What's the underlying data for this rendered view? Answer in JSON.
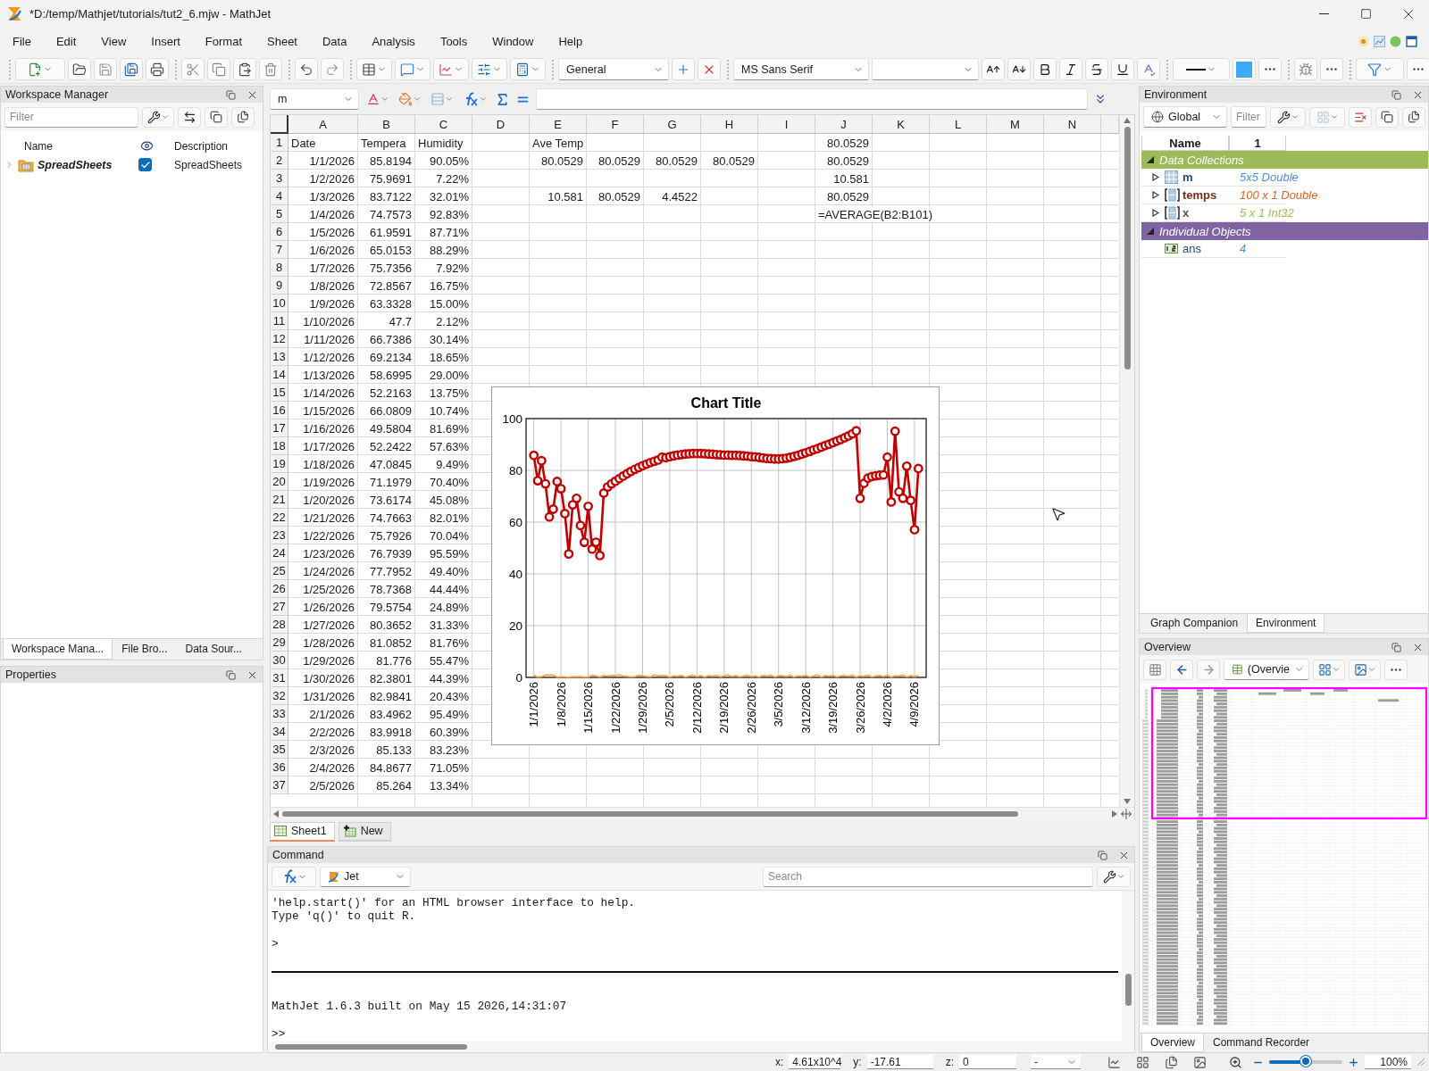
{
  "window": {
    "title": "*D:/temp/Mathjet/tutorials/tut2_6.mjw - MathJet"
  },
  "menu": [
    "File",
    "Edit",
    "View",
    "Insert",
    "Format",
    "Sheet",
    "Data",
    "Analysis",
    "Tools",
    "Window",
    "Help"
  ],
  "toolbar": {
    "number_format": "General",
    "font": "MS Sans Serif"
  },
  "workspace_manager": {
    "title": "Workspace Manager",
    "filter": {
      "placeholder": "Filter"
    },
    "columns": [
      "Name",
      "Description"
    ],
    "items": [
      {
        "name": "SpreadSheets",
        "description": "SpreadSheets",
        "checked": true,
        "expanded": false
      }
    ],
    "tabs": [
      {
        "label": "Workspace Mana...",
        "selected": true
      },
      {
        "label": "File Bro...",
        "selected": false
      },
      {
        "label": "Data Sour...",
        "selected": false
      }
    ]
  },
  "properties": {
    "title": "Properties"
  },
  "formula_bar": {
    "cell_name": "m"
  },
  "sheet": {
    "columns": [
      "A",
      "B",
      "C",
      "D",
      "E",
      "F",
      "G",
      "H",
      "I",
      "J",
      "K",
      "L",
      "M",
      "N"
    ],
    "rows": [
      {
        "number": "1",
        "labels": {
          "A": "Date",
          "B": "Tempera",
          "C": "Humidity",
          "E": "Ave Temp"
        },
        "values": {
          "J": "80.0529"
        }
      },
      {
        "number": "2",
        "values": {
          "A": "1/1/2026",
          "B": "85.8194",
          "C": "90.05%",
          "E": "80.0529",
          "F": "80.0529",
          "G": "80.0529",
          "H": "80.0529",
          "J": "80.0529"
        }
      },
      {
        "number": "3",
        "values": {
          "A": "1/2/2026",
          "B": "75.9691",
          "C": "7.22%",
          "J": "10.581"
        }
      },
      {
        "number": "4",
        "values": {
          "A": "1/3/2026",
          "B": "83.7122",
          "C": "32.01%",
          "E": "10.581",
          "F": "80.0529",
          "G": "4.4522",
          "J": "80.0529"
        }
      },
      {
        "number": "5",
        "values": {
          "A": "1/4/2026",
          "B": "74.7573",
          "C": "92.83%"
        },
        "labels": {
          "J": "=AVERAGE(B2:B101)"
        }
      },
      {
        "number": "6",
        "values": {
          "A": "1/5/2026",
          "B": "61.9591",
          "C": "87.71%"
        }
      },
      {
        "number": "7",
        "values": {
          "A": "1/6/2026",
          "B": "65.0153",
          "C": "88.29%"
        }
      },
      {
        "number": "8",
        "values": {
          "A": "1/7/2026",
          "B": "75.7356",
          "C": "7.92%"
        }
      },
      {
        "number": "9",
        "values": {
          "A": "1/8/2026",
          "B": "72.8567",
          "C": "16.75%"
        }
      },
      {
        "number": "10",
        "values": {
          "A": "1/9/2026",
          "B": "63.3328",
          "C": "15.00%"
        }
      },
      {
        "number": "11",
        "values": {
          "A": "1/10/2026",
          "B": "47.7",
          "C": "2.12%"
        }
      },
      {
        "number": "12",
        "values": {
          "A": "1/11/2026",
          "B": "66.7386",
          "C": "30.14%"
        }
      },
      {
        "number": "13",
        "values": {
          "A": "1/12/2026",
          "B": "69.2134",
          "C": "18.65%"
        }
      },
      {
        "number": "14",
        "values": {
          "A": "1/13/2026",
          "B": "58.6995",
          "C": "29.00%"
        }
      },
      {
        "number": "15",
        "values": {
          "A": "1/14/2026",
          "B": "52.2163",
          "C": "13.75%"
        }
      },
      {
        "number": "16",
        "values": {
          "A": "1/15/2026",
          "B": "66.0809",
          "C": "10.74%"
        }
      },
      {
        "number": "17",
        "values": {
          "A": "1/16/2026",
          "B": "49.5804",
          "C": "81.69%"
        }
      },
      {
        "number": "18",
        "values": {
          "A": "1/17/2026",
          "B": "52.2422",
          "C": "57.63%"
        }
      },
      {
        "number": "19",
        "values": {
          "A": "1/18/2026",
          "B": "47.0845",
          "C": "9.49%"
        }
      },
      {
        "number": "20",
        "values": {
          "A": "1/19/2026",
          "B": "71.1979",
          "C": "70.40%"
        }
      },
      {
        "number": "21",
        "values": {
          "A": "1/20/2026",
          "B": "73.6174",
          "C": "45.08%"
        }
      },
      {
        "number": "22",
        "values": {
          "A": "1/21/2026",
          "B": "74.7663",
          "C": "82.01%"
        }
      },
      {
        "number": "23",
        "values": {
          "A": "1/22/2026",
          "B": "75.7926",
          "C": "70.04%"
        }
      },
      {
        "number": "24",
        "values": {
          "A": "1/23/2026",
          "B": "76.7939",
          "C": "95.59%"
        }
      },
      {
        "number": "25",
        "values": {
          "A": "1/24/2026",
          "B": "77.7952",
          "C": "49.40%"
        }
      },
      {
        "number": "26",
        "values": {
          "A": "1/25/2026",
          "B": "78.7368",
          "C": "44.44%"
        }
      },
      {
        "number": "27",
        "values": {
          "A": "1/26/2026",
          "B": "79.5754",
          "C": "24.89%"
        }
      },
      {
        "number": "28",
        "values": {
          "A": "1/27/2026",
          "B": "80.3652",
          "C": "31.33%"
        }
      },
      {
        "number": "29",
        "values": {
          "A": "1/28/2026",
          "B": "81.0852",
          "C": "81.76%"
        }
      },
      {
        "number": "30",
        "values": {
          "A": "1/29/2026",
          "B": "81.776",
          "C": "55.47%"
        }
      },
      {
        "number": "31",
        "values": {
          "A": "1/30/2026",
          "B": "82.3801",
          "C": "44.39%"
        }
      },
      {
        "number": "32",
        "values": {
          "A": "1/31/2026",
          "B": "82.9841",
          "C": "20.43%"
        }
      },
      {
        "number": "33",
        "values": {
          "A": "2/1/2026",
          "B": "83.4962",
          "C": "95.49%"
        }
      },
      {
        "number": "34",
        "values": {
          "A": "2/2/2026",
          "B": "83.9918",
          "C": "60.39%"
        }
      },
      {
        "number": "35",
        "values": {
          "A": "2/3/2026",
          "B": "85.133",
          "C": "83.23%"
        }
      },
      {
        "number": "36",
        "values": {
          "A": "2/4/2026",
          "B": "84.8677",
          "C": "71.05%"
        }
      },
      {
        "number": "37",
        "values": {
          "A": "2/5/2026",
          "B": "85.264",
          "C": "13.34%"
        }
      }
    ],
    "chart_data": {
      "type": "line",
      "title": "Chart Title",
      "grid": true,
      "categories": [
        "1/1/2026",
        null,
        null,
        null,
        null,
        null,
        null,
        "1/8/2026",
        null,
        null,
        null,
        null,
        null,
        null,
        "1/15/2026",
        null,
        null,
        null,
        null,
        null,
        null,
        "1/22/2026",
        null,
        null,
        null,
        null,
        null,
        null,
        "1/29/2026",
        null,
        null,
        null,
        null,
        null,
        null,
        "2/5/2026",
        null,
        null,
        null,
        null,
        null,
        null,
        "2/12/2026",
        null,
        null,
        null,
        null,
        null,
        null,
        "2/19/2026",
        null,
        null,
        null,
        null,
        null,
        null,
        "2/26/2026",
        null,
        null,
        null,
        null,
        null,
        null,
        "3/5/2026",
        null,
        null,
        null,
        null,
        null,
        null,
        "3/12/2026",
        null,
        null,
        null,
        null,
        null,
        null,
        "3/19/2026",
        null,
        null,
        null,
        null,
        null,
        null,
        "3/26/2026",
        null,
        null,
        null,
        null,
        null,
        null,
        "4/2/2026",
        null,
        null,
        null,
        null,
        null,
        null,
        "4/9/2026",
        null
      ],
      "ylim": [
        0,
        100
      ],
      "yticks": [
        {
          "value": 0,
          "label": "0"
        },
        {
          "value": 20,
          "label": "20"
        },
        {
          "value": 40,
          "label": "40"
        },
        {
          "value": 60,
          "label": "60"
        },
        {
          "value": 80,
          "label": "80"
        },
        {
          "value": 100,
          "label": "100"
        }
      ],
      "series": [
        {
          "color": "#c00000",
          "marker": "circle",
          "values": [
            85.8,
            76.0,
            83.7,
            74.8,
            62.0,
            65.0,
            75.7,
            72.9,
            63.3,
            47.7,
            66.7,
            69.2,
            58.7,
            52.2,
            66.1,
            49.6,
            52.2,
            47.1,
            71.2,
            73.6,
            74.8,
            75.8,
            76.8,
            77.8,
            78.7,
            79.6,
            80.4,
            81.1,
            81.8,
            82.4,
            83.0,
            83.5,
            84.0,
            85.1,
            84.9,
            85.3,
            85.6,
            85.9,
            86.1,
            86.3,
            86.4,
            86.5,
            86.5,
            86.5,
            86.4,
            86.3,
            86.2,
            86.1,
            86.0,
            85.9,
            85.9,
            85.8,
            85.8,
            85.7,
            85.6,
            85.5,
            85.3,
            85.2,
            85.0,
            84.8,
            84.6,
            84.5,
            84.4,
            84.4,
            84.5,
            84.7,
            85.0,
            85.4,
            85.8,
            86.3,
            86.8,
            87.3,
            87.9,
            88.4,
            89.0,
            89.6,
            90.1,
            90.7,
            91.3,
            91.9,
            92.6,
            93.3,
            94.1,
            95.3,
            69.2,
            75.0,
            77.0,
            77.6,
            77.9,
            78.1,
            78.2,
            85.1,
            67.8,
            95.1,
            71.7,
            69.2,
            81.6,
            68.4,
            57.1,
            80.7
          ]
        },
        {
          "color": "#f4a23c",
          "marker": "none",
          "values": [
            0.9,
            0.1,
            0.3,
            0.9,
            0.9,
            0.9,
            0.1,
            0.2,
            0.2,
            0,
            0.3,
            0.2,
            0.3,
            0.1,
            0.1,
            0.8,
            0.6,
            0.1,
            0.7,
            0.5,
            0.8,
            0.7,
            1,
            0.5,
            0.4,
            0.2,
            0.3,
            0.8,
            0.6,
            0.4,
            0.2,
            1,
            0.6,
            0.8,
            0.7,
            0.1,
            0.6,
            0.4,
            0.8,
            0.1,
            0.5,
            0.9,
            0.3,
            0.7,
            0.1,
            0.7,
            0.4,
            0.9,
            0.2,
            0.6,
            1,
            0.3,
            0.7,
            0.2,
            0.5,
            0.8,
            0.3,
            0.6,
            0.1,
            0.8,
            0.4,
            0.9,
            0.2,
            0.6,
            0.7,
            0.3,
            0.9,
            0.1,
            0.6,
            0.4,
            0.8,
            0.2,
            0.5,
            1,
            0.1,
            0.7,
            0.5,
            0.8,
            0.2,
            0.6,
            0.7,
            0.4,
            0.9,
            0.1,
            0.6,
            0.4,
            0.9,
            0.2,
            0.5,
            0.8,
            0.3,
            0.9,
            0.1,
            0.6,
            0.5,
            0.9,
            0.2,
            0.7,
            0.3,
            0.8
          ]
        }
      ]
    },
    "tabs": [
      {
        "label": "Sheet1",
        "selected": true,
        "kind": "sheet"
      },
      {
        "label": "New",
        "selected": false,
        "kind": "add"
      }
    ]
  },
  "command": {
    "title": "Command",
    "engine": "Jet",
    "search": {
      "placeholder": "Search"
    },
    "output": [
      {
        "kind": "text",
        "lines": [
          "'help.start()' for an HTML browser interface to help.",
          "Type 'q()' to quit R."
        ]
      },
      {
        "kind": "text",
        "lines": [
          ">"
        ]
      },
      {
        "kind": "rule"
      },
      {
        "kind": "text",
        "lines": [
          "MathJet 1.6.3 built on May 15 2026,14:31:07"
        ]
      },
      {
        "kind": "text",
        "lines": [
          ">>"
        ]
      }
    ]
  },
  "environment": {
    "title": "Environment",
    "scope": "Global",
    "filter": {
      "placeholder": "Filter"
    },
    "columns": [
      "Name",
      "1"
    ],
    "groups": [
      {
        "label": "Data Collections",
        "color": "#9bbb59",
        "expanded": true,
        "children": [
          {
            "name": "m",
            "value": "5x5 Double",
            "color": "#4a90d9",
            "kind": "matrix",
            "expanded": false
          },
          {
            "name": "temps",
            "value": "100 x 1 Double",
            "color": "#d9622b",
            "kind": "vector",
            "expanded": false
          },
          {
            "name": "x",
            "value": "5 x 1 Int32",
            "color": "#9bbb59",
            "kind": "vector",
            "expanded": false
          }
        ]
      },
      {
        "label": "Individual Objects",
        "color": "#8064a2",
        "expanded": true,
        "children": [
          {
            "name": "ans",
            "value": "4",
            "color": "#4a90d9",
            "kind": "scalar"
          }
        ]
      }
    ],
    "tabs": [
      {
        "label": "Graph Companion",
        "selected": false
      },
      {
        "label": "Environment",
        "selected": true
      }
    ]
  },
  "overview": {
    "title": "Overview",
    "view": "(Overvie",
    "tabs": [
      {
        "label": "Overview",
        "selected": true
      },
      {
        "label": "Command Recorder",
        "selected": false
      }
    ]
  },
  "status_bar": {
    "fields": [
      {
        "label": "x:",
        "value": "4.61x10^4"
      },
      {
        "label": "y:",
        "value": "-17.61"
      },
      {
        "label": "z:",
        "value": "0"
      }
    ],
    "mode": "-",
    "zoom": {
      "level": 0.5,
      "reading": "100%"
    }
  }
}
